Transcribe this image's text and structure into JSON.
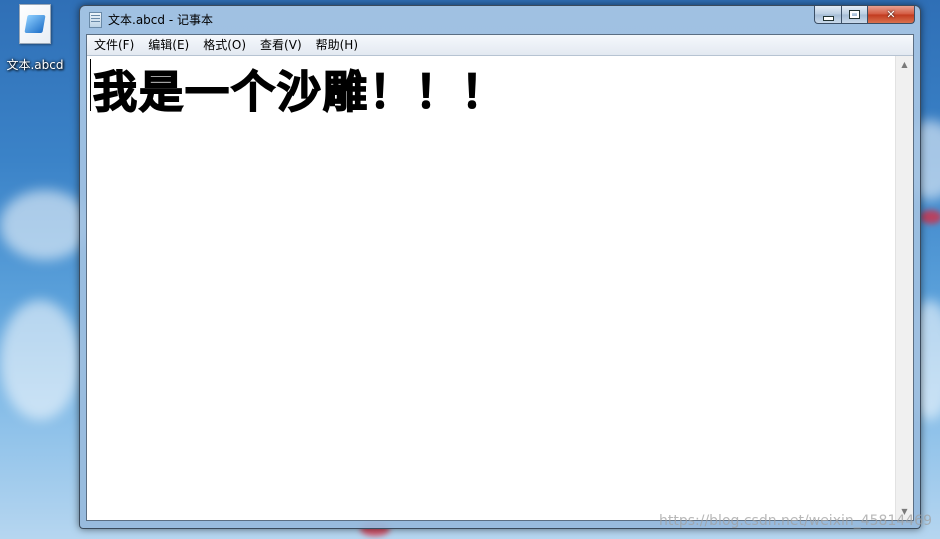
{
  "desktop": {
    "icon_label": "文本.abcd",
    "icon": "text-document-icon"
  },
  "window": {
    "title": "文本.abcd - 记事本",
    "app_icon": "notepad-icon",
    "caption": {
      "minimize": "minimize-icon",
      "maximize": "maximize-icon",
      "close_glyph": "✕"
    }
  },
  "menu": [
    {
      "label": "文件(F)"
    },
    {
      "label": "编辑(E)"
    },
    {
      "label": "格式(O)"
    },
    {
      "label": "查看(V)"
    },
    {
      "label": "帮助(H)"
    }
  ],
  "editor": {
    "content": "我是一个沙雕！！！"
  },
  "scrollbar": {
    "up": "▲",
    "down": "▼"
  },
  "watermark": "https://blog.csdn.net/weixin_45814469"
}
